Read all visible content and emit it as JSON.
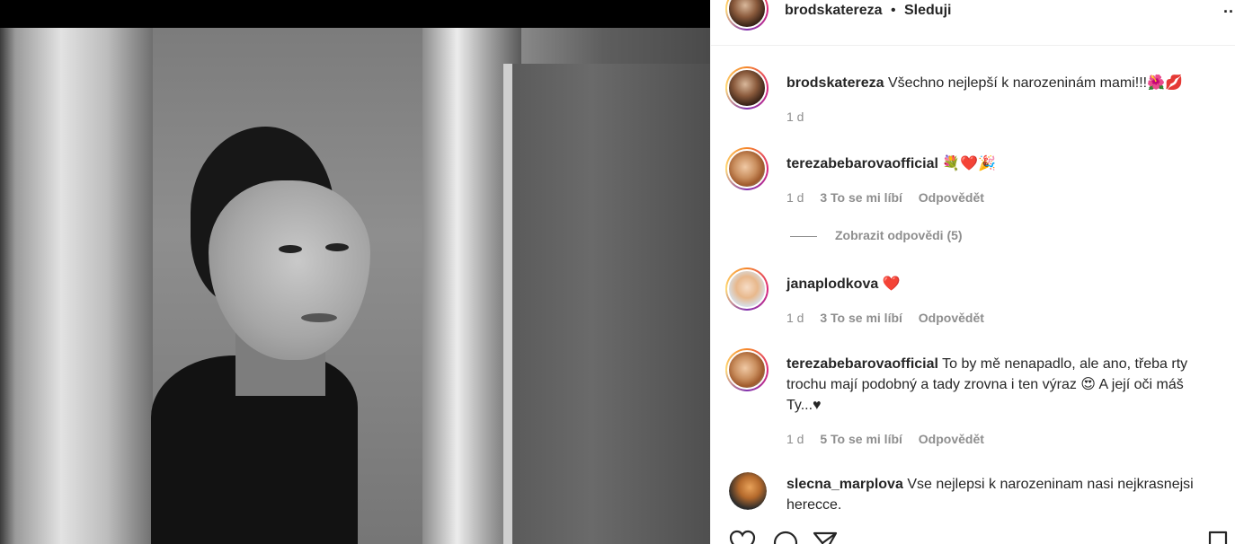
{
  "post": {
    "username": "brodskatereza",
    "separator": "•",
    "follow_label": "Sleduji",
    "more_icon": "more-options-icon",
    "more_label": "..."
  },
  "comments": [
    {
      "username": "brodskatereza",
      "text": "Všechno nejlepší k narozeninám mami!!!",
      "emojis": "🌺💋",
      "time": "1 d"
    },
    {
      "username": "terezabebarovaofficial",
      "text": "",
      "emojis": "💐❤️🎉",
      "time": "1 d",
      "likes": "3 To se mi líbí",
      "reply_label": "Odpovědět",
      "view_replies": "Zobrazit odpovědi (5)"
    },
    {
      "username": "janaplodkova",
      "text": "",
      "emojis": "❤️",
      "time": "1 d",
      "likes": "3 To se mi líbí",
      "reply_label": "Odpovědět"
    },
    {
      "username": "terezabebarovaofficial",
      "text": "To by mě nenapadlo, ale ano, třeba rty trochu mají podobný a tady zrovna i ten výraz 😍 A její oči máš Ty...♥",
      "time": "1 d",
      "likes": "5 To se mi líbí",
      "reply_label": "Odpovědět"
    },
    {
      "username": "slecna_marplova",
      "text": "Vse nejlepsi k narozeninam nasi nejkrasnejsi herecce."
    }
  ],
  "actions": {
    "like_icon": "heart-icon",
    "comment_icon": "comment-icon",
    "share_icon": "share-icon",
    "save_icon": "bookmark-icon"
  }
}
